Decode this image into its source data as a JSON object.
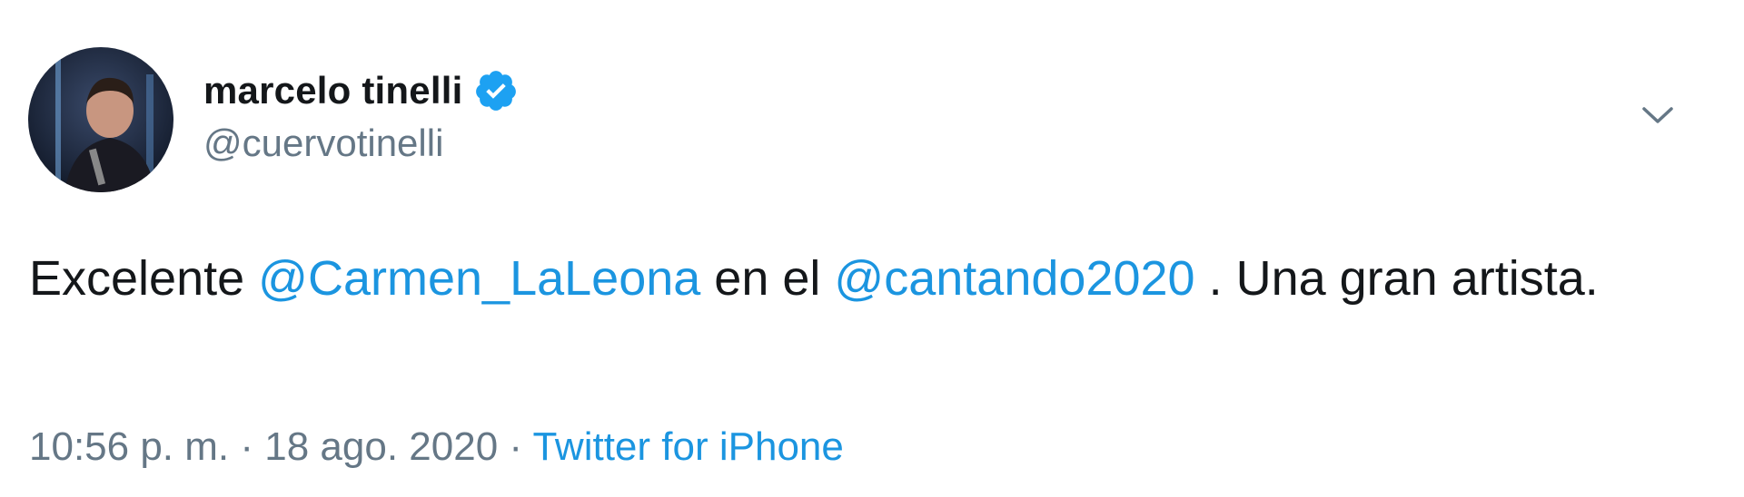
{
  "user": {
    "display_name": "marcelo tinelli",
    "handle": "@cuervotinelli",
    "verified": true
  },
  "tweet": {
    "text_part1": "Excelente ",
    "mention1": "@Carmen_LaLeona",
    "text_part2": " en el ",
    "mention2": "@cantando2020",
    "text_part3": " . Una gran artista."
  },
  "meta": {
    "time": "10:56 p. m.",
    "separator1": " · ",
    "date": "18 ago. 2020",
    "separator2": " · ",
    "source": "Twitter for iPhone"
  },
  "icons": {
    "avatar": "avatar-icon",
    "verified": "verified-badge-icon",
    "caret": "chevron-down-icon"
  },
  "colors": {
    "link": "#1b95e0",
    "secondary_text": "#657786",
    "primary_text": "#14171a",
    "verified": "#1da1f2"
  }
}
